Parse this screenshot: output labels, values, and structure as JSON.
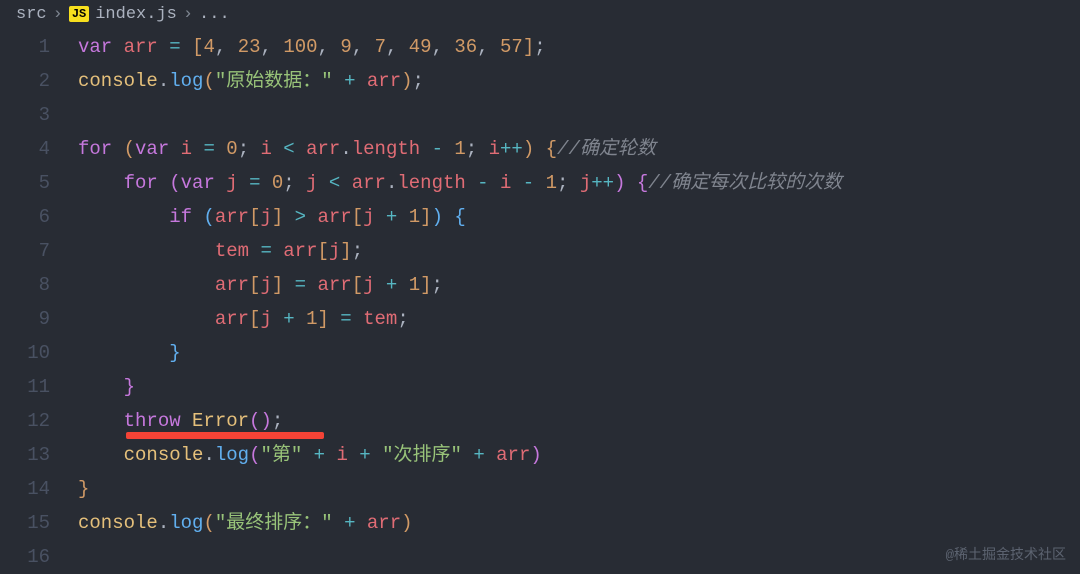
{
  "breadcrumb": {
    "folder": "src",
    "badge": "JS",
    "file": "index.js",
    "more": "..."
  },
  "lineNumbers": [
    "1",
    "2",
    "3",
    "4",
    "5",
    "6",
    "7",
    "8",
    "9",
    "10",
    "11",
    "12",
    "13",
    "14",
    "15",
    "16"
  ],
  "code": {
    "l1_var": "var",
    "l1_arr": "arr",
    "l1_eq": " = ",
    "l1_open": "[",
    "l1_n1": "4",
    "l1_n2": "23",
    "l1_n3": "100",
    "l1_n4": "9",
    "l1_n5": "7",
    "l1_n6": "49",
    "l1_n7": "36",
    "l1_n8": "57",
    "l1_close": "]",
    "l1_semi": ";",
    "l2_console": "console",
    "l2_dot": ".",
    "l2_log": "log",
    "l2_open": "(",
    "l2_str": "\"原始数据：\"",
    "l2_plus": " + ",
    "l2_arr": "arr",
    "l2_close": ")",
    "l2_semi": ";",
    "l4_for": "for",
    "l4_open": " (",
    "l4_var": "var",
    "l4_i": "i",
    "l4_eq": " = ",
    "l4_zero": "0",
    "l4_semi1": "; ",
    "l4_i2": "i",
    "l4_lt": " < ",
    "l4_arr": "arr",
    "l4_dot": ".",
    "l4_length": "length",
    "l4_minus": " - ",
    "l4_one": "1",
    "l4_semi2": "; ",
    "l4_i3": "i",
    "l4_inc": "++",
    "l4_close": ") ",
    "l4_brace": "{",
    "l4_comment": "//确定轮数",
    "l5_for": "for",
    "l5_open": " (",
    "l5_var": "var",
    "l5_j": "j",
    "l5_eq": " = ",
    "l5_zero": "0",
    "l5_semi1": "; ",
    "l5_j2": "j",
    "l5_lt": " < ",
    "l5_arr": "arr",
    "l5_dot": ".",
    "l5_length": "length",
    "l5_minus1": " - ",
    "l5_i": "i",
    "l5_minus2": " - ",
    "l5_one": "1",
    "l5_semi2": "; ",
    "l5_j3": "j",
    "l5_inc": "++",
    "l5_close": ") ",
    "l5_brace": "{",
    "l5_comment": "//确定每次比较的次数",
    "l6_if": "if",
    "l6_open": " (",
    "l6_arr1": "arr",
    "l6_b1o": "[",
    "l6_j1": "j",
    "l6_b1c": "]",
    "l6_gt": " > ",
    "l6_arr2": "arr",
    "l6_b2o": "[",
    "l6_j2": "j",
    "l6_plus": " + ",
    "l6_one": "1",
    "l6_b2c": "]",
    "l6_close": ") ",
    "l6_brace": "{",
    "l7_tem": "tem",
    "l7_eq": " = ",
    "l7_arr": "arr",
    "l7_bo": "[",
    "l7_j": "j",
    "l7_bc": "]",
    "l7_semi": ";",
    "l8_arr1": "arr",
    "l8_b1o": "[",
    "l8_j1": "j",
    "l8_b1c": "]",
    "l8_eq": " = ",
    "l8_arr2": "arr",
    "l8_b2o": "[",
    "l8_j2": "j",
    "l8_plus": " + ",
    "l8_one": "1",
    "l8_b2c": "]",
    "l8_semi": ";",
    "l9_arr": "arr",
    "l9_bo": "[",
    "l9_j": "j",
    "l9_plus": " + ",
    "l9_one": "1",
    "l9_bc": "]",
    "l9_eq": " = ",
    "l9_tem": "tem",
    "l9_semi": ";",
    "l10_brace": "}",
    "l11_brace": "}",
    "l12_throw": "throw",
    "l12_error": "Error",
    "l12_open": "(",
    "l12_close": ")",
    "l12_semi": ";",
    "l13_console": "console",
    "l13_dot": ".",
    "l13_log": "log",
    "l13_open": "(",
    "l13_str1": "\"第\"",
    "l13_plus1": " + ",
    "l13_i": "i",
    "l13_plus2": " + ",
    "l13_str2": "\"次排序\"",
    "l13_plus3": " + ",
    "l13_arr": "arr",
    "l13_close": ")",
    "l14_brace": "}",
    "l15_console": "console",
    "l15_dot": ".",
    "l15_log": "log",
    "l15_open": "(",
    "l15_str": "\"最终排序：\"",
    "l15_plus": " + ",
    "l15_arr": "arr",
    "l15_close": ")"
  },
  "watermark": "@稀土掘金技术社区"
}
